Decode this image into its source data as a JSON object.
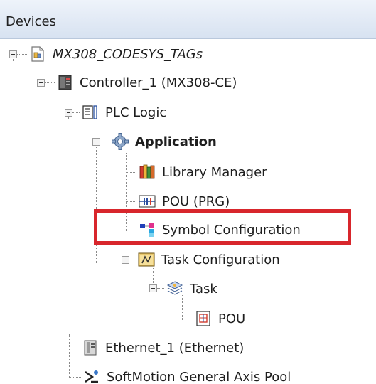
{
  "panel": {
    "title": "Devices"
  },
  "tree": {
    "project": "MX308_CODESYS_TAGs",
    "controller": "Controller_1 (MX308-CE)",
    "plc_logic": "PLC Logic",
    "application": "Application",
    "library_manager": "Library Manager",
    "pou_prg": "POU (PRG)",
    "symbol_configuration": "Symbol Configuration",
    "task_configuration": "Task Configuration",
    "task": "Task",
    "pou": "POU",
    "ethernet": "Ethernet_1 (Ethernet)",
    "softmotion": "SoftMotion General Axis Pool"
  },
  "colors": {
    "highlight": "#d8262c"
  }
}
